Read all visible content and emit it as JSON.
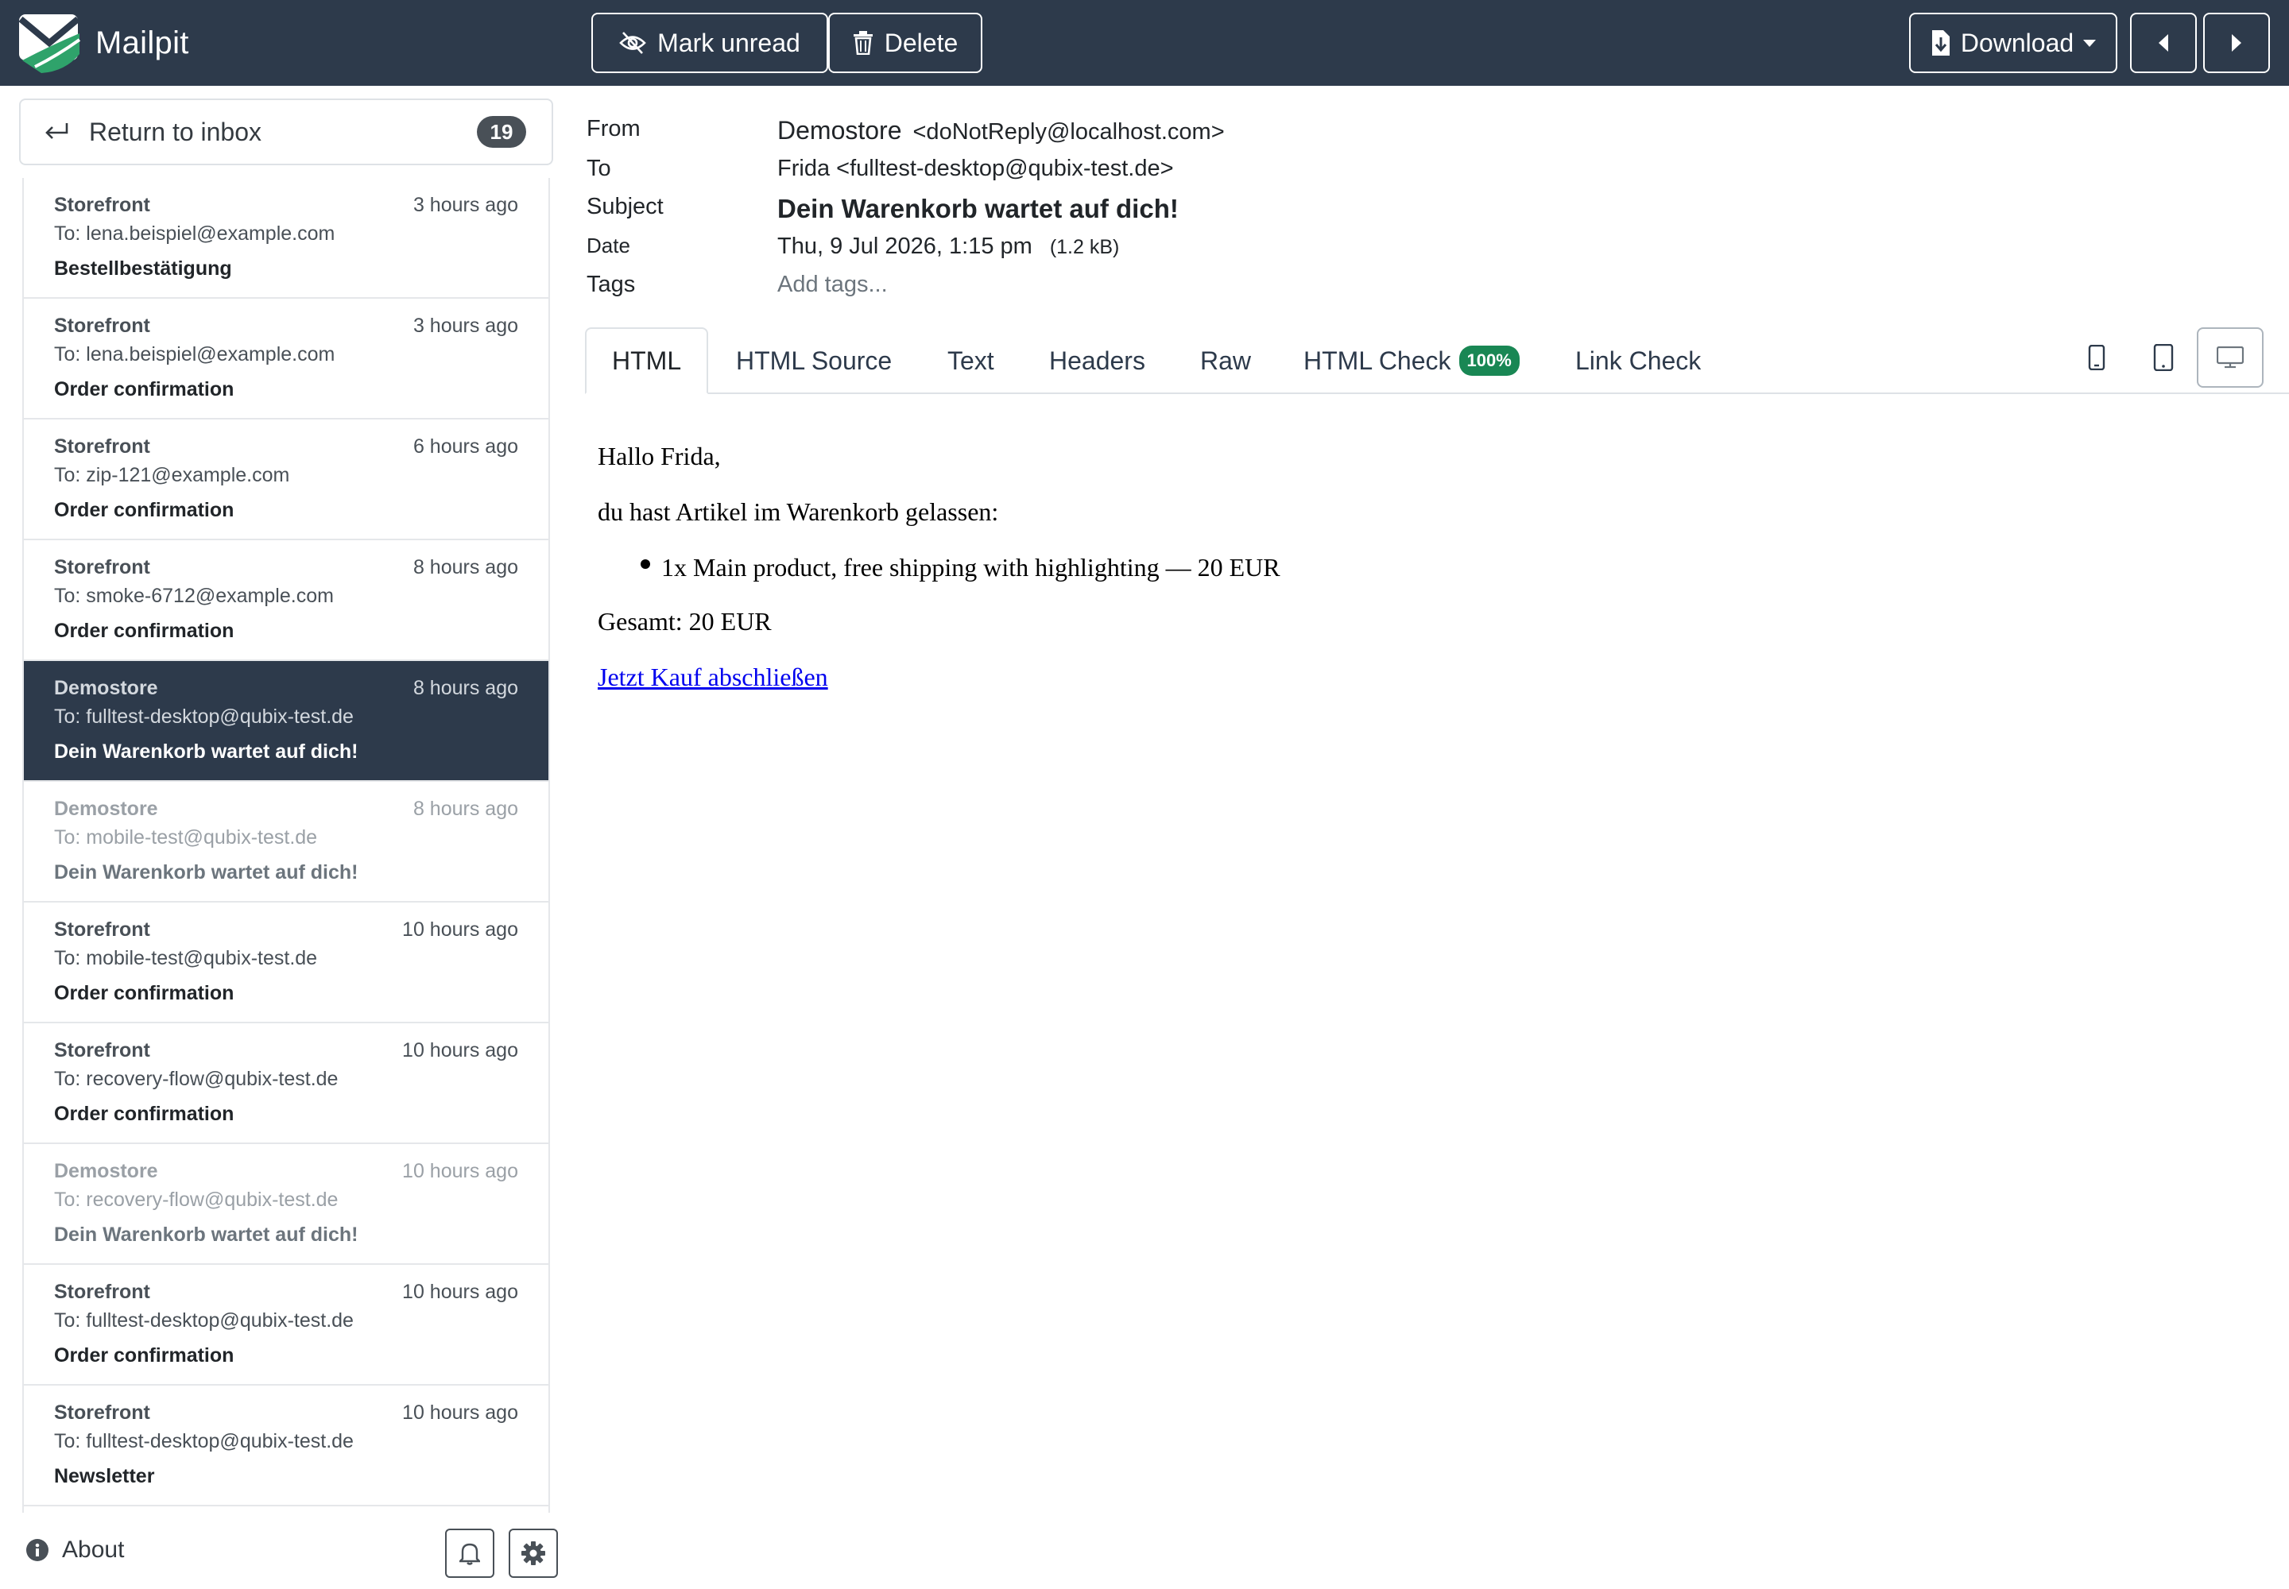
{
  "app": {
    "name": "Mailpit"
  },
  "toolbar": {
    "mark_unread": "Mark unread",
    "delete": "Delete",
    "download": "Download"
  },
  "sidebar": {
    "return_label": "Return to inbox",
    "unread_count": "19",
    "about": "About",
    "messages": [
      {
        "from": "Storefront",
        "time": "3 hours ago",
        "to": "To: lena.beispiel@example.com",
        "subject": "Bestellbestätigung",
        "state": "unread"
      },
      {
        "from": "Storefront",
        "time": "3 hours ago",
        "to": "To: lena.beispiel@example.com",
        "subject": "Order confirmation",
        "state": "unread"
      },
      {
        "from": "Storefront",
        "time": "6 hours ago",
        "to": "To: zip-121@example.com",
        "subject": "Order confirmation",
        "state": "unread"
      },
      {
        "from": "Storefront",
        "time": "8 hours ago",
        "to": "To: smoke-6712@example.com",
        "subject": "Order confirmation",
        "state": "unread"
      },
      {
        "from": "Demostore",
        "time": "8 hours ago",
        "to": "To: fulltest-desktop@qubix-test.de",
        "subject": "Dein Warenkorb wartet auf dich!",
        "state": "active"
      },
      {
        "from": "Demostore",
        "time": "8 hours ago",
        "to": "To: mobile-test@qubix-test.de",
        "subject": "Dein Warenkorb wartet auf dich!",
        "state": "read"
      },
      {
        "from": "Storefront",
        "time": "10 hours ago",
        "to": "To: mobile-test@qubix-test.de",
        "subject": "Order confirmation",
        "state": "unread"
      },
      {
        "from": "Storefront",
        "time": "10 hours ago",
        "to": "To: recovery-flow@qubix-test.de",
        "subject": "Order confirmation",
        "state": "unread"
      },
      {
        "from": "Demostore",
        "time": "10 hours ago",
        "to": "To: recovery-flow@qubix-test.de",
        "subject": "Dein Warenkorb wartet auf dich!",
        "state": "read"
      },
      {
        "from": "Storefront",
        "time": "10 hours ago",
        "to": "To: fulltest-desktop@qubix-test.de",
        "subject": "Order confirmation",
        "state": "unread"
      },
      {
        "from": "Storefront",
        "time": "10 hours ago",
        "to": "To: fulltest-desktop@qubix-test.de",
        "subject": "Newsletter",
        "state": "unread"
      }
    ]
  },
  "message": {
    "labels": {
      "from": "From",
      "to": "To",
      "subject": "Subject",
      "date": "Date",
      "tags": "Tags"
    },
    "from_name": "Demostore",
    "from_addr": "<doNotReply@localhost.com>",
    "to": "Frida <fulltest-desktop@qubix-test.de>",
    "subject": "Dein Warenkorb wartet auf dich!",
    "date": "Thu, 9 Jul 2026, 1:15 pm",
    "size": "(1.2 kB)",
    "tags_placeholder": "Add tags..."
  },
  "tabs": {
    "html": "HTML",
    "html_source": "HTML Source",
    "text": "Text",
    "headers": "Headers",
    "raw": "Raw",
    "html_check": "HTML Check",
    "html_check_score": "100%",
    "link_check": "Link Check"
  },
  "email_body": {
    "greeting": "Hallo Frida,",
    "intro": "du hast Artikel im Warenkorb gelassen:",
    "item": "1x Main product, free shipping with highlighting — 20 EUR",
    "total": "Gesamt: 20 EUR",
    "cta": "Jetzt Kauf abschließen"
  },
  "icons": {
    "mark_unread": "eye-slash-icon",
    "delete": "trash-icon",
    "download": "file-download-icon",
    "prev": "caret-left-icon",
    "next": "caret-right-icon",
    "return": "return-arrow-icon",
    "about": "info-circle-icon",
    "notifications": "bell-icon",
    "settings": "gear-icon",
    "view_phone": "phone-icon",
    "view_tablet": "tablet-icon",
    "view_desktop": "desktop-icon"
  },
  "colors": {
    "navbar": "#2d3a4b",
    "active_item": "#2d3a4b",
    "badge_green": "#198754",
    "badge_count": "#495057",
    "link": "#0000ee"
  }
}
